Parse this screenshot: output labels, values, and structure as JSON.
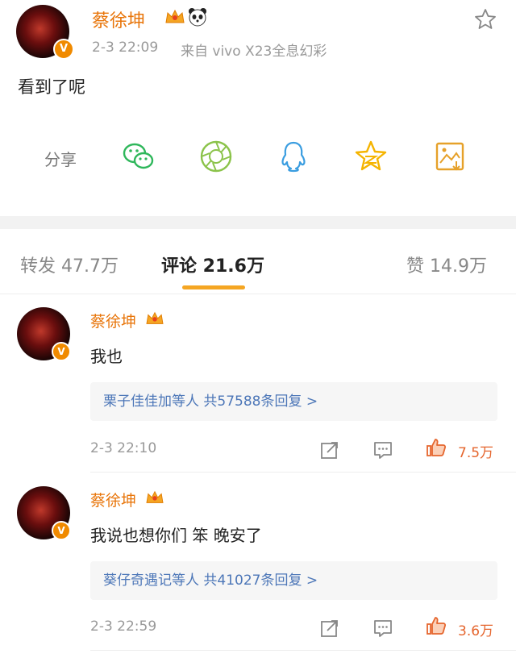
{
  "post": {
    "author": "蔡徐坤",
    "timestamp": "2-3 22:09",
    "source": "来自 vivo X23全息幻彩",
    "text": "看到了呢",
    "verified_badge": "V"
  },
  "share": {
    "label": "分享",
    "icons": [
      "wechat-icon",
      "moments-icon",
      "qq-icon",
      "qzone-icon",
      "save-image-icon"
    ],
    "colors": {
      "wechat": "#2fb75b",
      "moments": "#8bc34a",
      "qq": "#3a9de0",
      "qzone": "#f5b400",
      "save": "#e6a12a"
    }
  },
  "tabs": {
    "repost": "转发 47.7万",
    "comments": "评论 21.6万",
    "likes": "赞 14.9万",
    "active_color": "#f5a623"
  },
  "comments": [
    {
      "author": "蔡徐坤",
      "text": "我也",
      "replies": "栗子佳佳加等人 共57588条回复 >",
      "time": "2-3 22:10",
      "likes": "7.5万"
    },
    {
      "author": "蔡徐坤",
      "text": "我说也想你们 笨 晚安了",
      "replies": "葵仔奇遇记等人 共41027条回复 >",
      "time": "2-3 22:59",
      "likes": "3.6万"
    }
  ],
  "colors": {
    "name": "#e8750a",
    "link": "#4d77b8",
    "like": "#e5652d"
  }
}
